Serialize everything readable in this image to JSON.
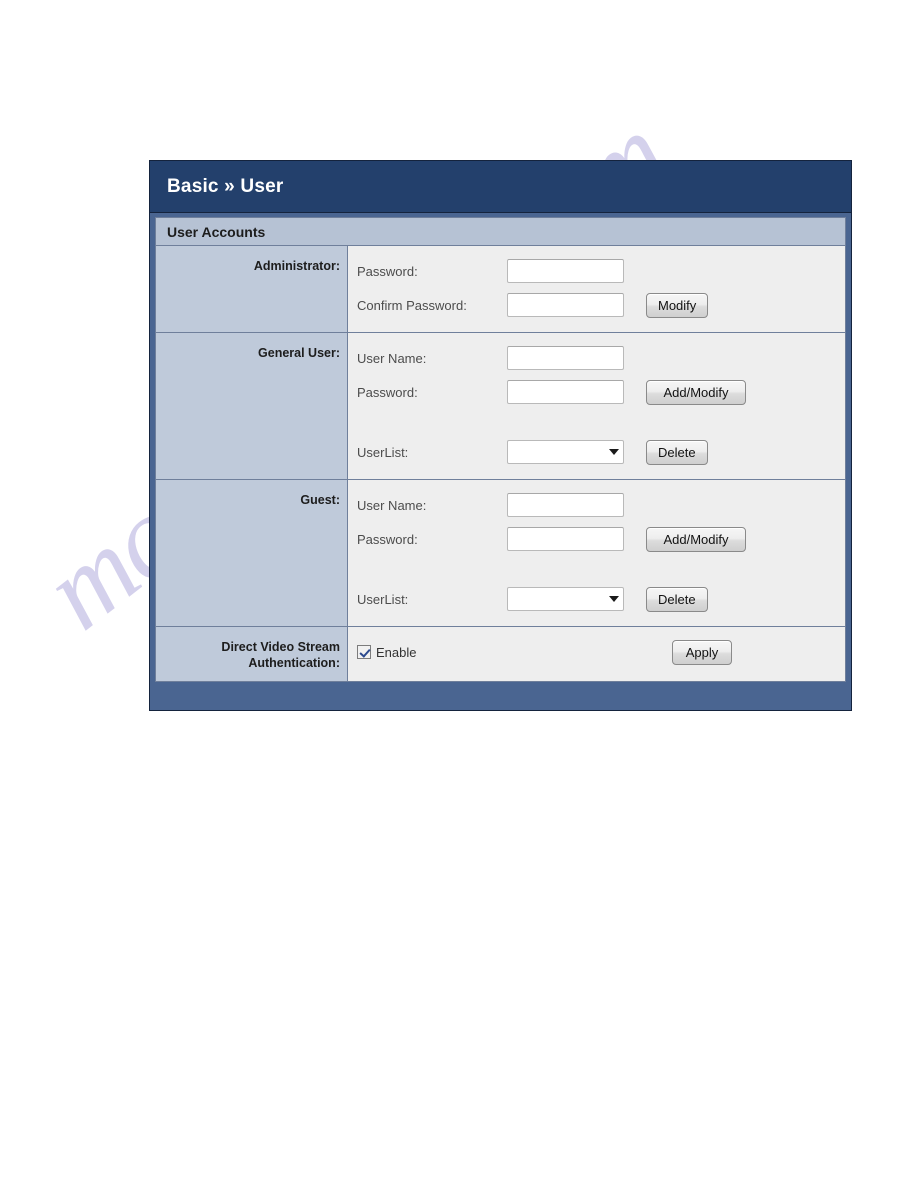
{
  "watermark": {
    "text": "manualshive.com"
  },
  "panel": {
    "title": "Basic » User",
    "section_title": "User Accounts",
    "colors": {
      "titlebar": "#23406c",
      "section_header": "#b6c2d4",
      "label_column": "#bfcada",
      "field_background": "#eeeeee",
      "panel_frame": "#4a6591",
      "checkmark": "#2b4a8f",
      "watermark": "#cdc9e9"
    },
    "rows": [
      {
        "label": "Administrator:",
        "fields": [
          {
            "caption": "Password:",
            "type": "password",
            "value": "",
            "placeholder": ""
          },
          {
            "caption": "Confirm Password:",
            "type": "password",
            "value": "",
            "placeholder": ""
          }
        ],
        "button": "Modify"
      },
      {
        "label": "General User:",
        "fields": [
          {
            "caption": "User Name:",
            "type": "text",
            "value": "",
            "placeholder": ""
          },
          {
            "caption": "Password:",
            "type": "password",
            "value": "",
            "placeholder": ""
          },
          {
            "caption": "UserList:",
            "type": "select",
            "value": "",
            "options": []
          }
        ],
        "button": "Add/Modify",
        "button2": "Delete"
      },
      {
        "label": "Guest:",
        "fields": [
          {
            "caption": "User Name:",
            "type": "text",
            "value": "",
            "placeholder": ""
          },
          {
            "caption": "Password:",
            "type": "password",
            "value": "",
            "placeholder": ""
          },
          {
            "caption": "UserList:",
            "type": "select",
            "value": "",
            "options": []
          }
        ],
        "button": "Add/Modify",
        "button2": "Delete"
      },
      {
        "label": "Direct Video Stream Authentication:",
        "checkbox": {
          "label": "Enable",
          "checked": true
        },
        "button": "Apply"
      }
    ]
  }
}
